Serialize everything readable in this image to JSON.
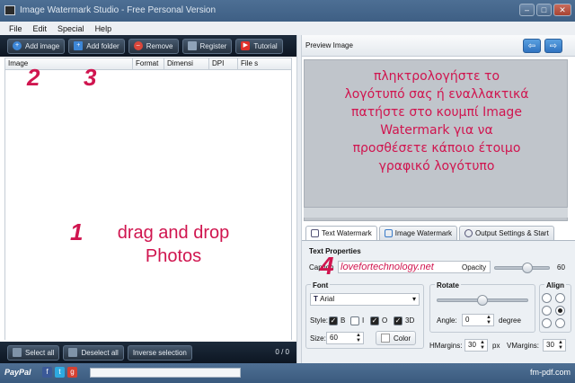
{
  "window": {
    "title": "Image Watermark Studio - Free Personal Version"
  },
  "menu": [
    "File",
    "Edit",
    "Special",
    "Help"
  ],
  "toolbar": {
    "add_image": "Add image",
    "add_folder": "Add folder",
    "remove": "Remove",
    "register": "Register",
    "tutorial": "Tutorial"
  },
  "list": {
    "columns": [
      "Image",
      "Format",
      "Dimensi",
      "DPI",
      "File s"
    ],
    "count": "0 / 0"
  },
  "annotations": {
    "num1": "1",
    "num2": "2",
    "num3": "3",
    "num4": "4",
    "drag_line1": "drag and drop",
    "drag_line2": "Photos"
  },
  "bottom": {
    "select_all": "Select all",
    "deselect_all": "Deselect all",
    "inverse": "Inverse selection"
  },
  "preview": {
    "label": "Preview Image",
    "text_lines": [
      "πληκτρολογήστε το",
      "λογότυπό σας ή εναλλακτικά",
      "πατήστε στο κουμπί Image",
      "Watermark για να",
      "προσθέσετε κάποιο έτοιμο",
      "γραφικό λογότυπο"
    ]
  },
  "tabs": [
    "Text Watermark",
    "Image Watermark",
    "Output Settings & Start"
  ],
  "text_props": {
    "group": "Text Properties",
    "caption_label": "Caption",
    "caption_value": "lovefortechnology.net",
    "opacity_label": "Opacity",
    "opacity_value": "60",
    "opacity_level": 0.6
  },
  "font": {
    "group": "Font",
    "family": "Arial",
    "style_label": "Style:",
    "b": "B",
    "i": "I",
    "o": "O",
    "d3": "3D",
    "size_label": "Size:",
    "size_value": "60",
    "color_label": "Color"
  },
  "rotate": {
    "group": "Rotate",
    "angle_label": "Angle:",
    "angle_value": "0",
    "unit": "degree",
    "level": 0.5
  },
  "align": {
    "group": "Align"
  },
  "margins": {
    "h_label": "HMargins:",
    "h_value": "30",
    "px": "px",
    "v_label": "VMargins:",
    "v_value": "30"
  },
  "status": {
    "paypal": "PayPal",
    "site": "fm-pdf.com"
  },
  "colors": {
    "accent_red": "#d0154f",
    "toolbar_bg": "#1d2b3c",
    "title_bg": "#4d6f94"
  }
}
